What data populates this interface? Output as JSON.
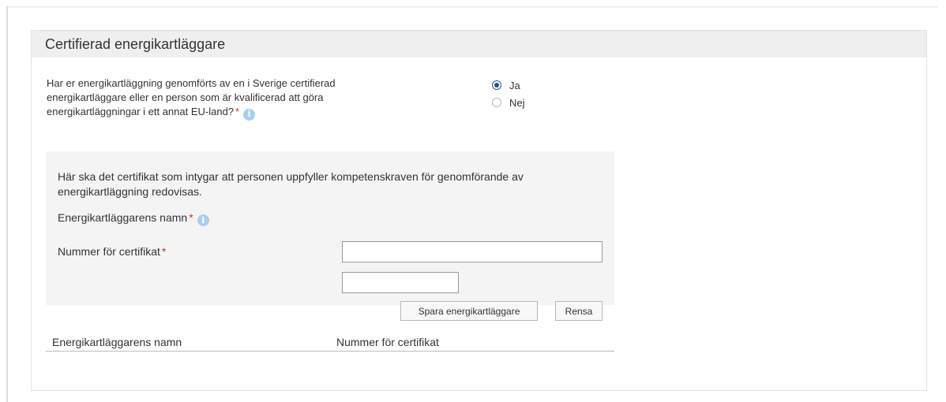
{
  "section": {
    "title": "Certifierad energikartläggare"
  },
  "question": {
    "text": "Har er energikartläggning genomförts av en i Sverige certifierad energikartläggare eller en person som är kvalificerad att göra energikartläggningar i ett annat EU-land?",
    "required_mark": "*",
    "info_icon": "info-circle-icon"
  },
  "radio": {
    "options": [
      {
        "label": "Ja",
        "checked": true
      },
      {
        "label": "Nej",
        "checked": false
      }
    ]
  },
  "certificate": {
    "description": "Här ska det certifikat som intygar att personen uppfyller kompetenskraven för genomförande av energikartläggning redovisas.",
    "name_label": "Energikartläggarens namn",
    "name_value": "",
    "number_label": "Nummer för certifikat",
    "number_value": "",
    "required_mark": "*",
    "save_button": "Spara energikartläggare",
    "clear_button": "Rensa"
  },
  "table": {
    "columns": [
      "Energikartläggarens namn",
      "Nummer för certifikat"
    ],
    "rows": []
  },
  "colors": {
    "header_bg": "#efefef",
    "required": "#c0392b",
    "info_icon": "#a9cdee",
    "radio_checked": "#1f4f86"
  }
}
